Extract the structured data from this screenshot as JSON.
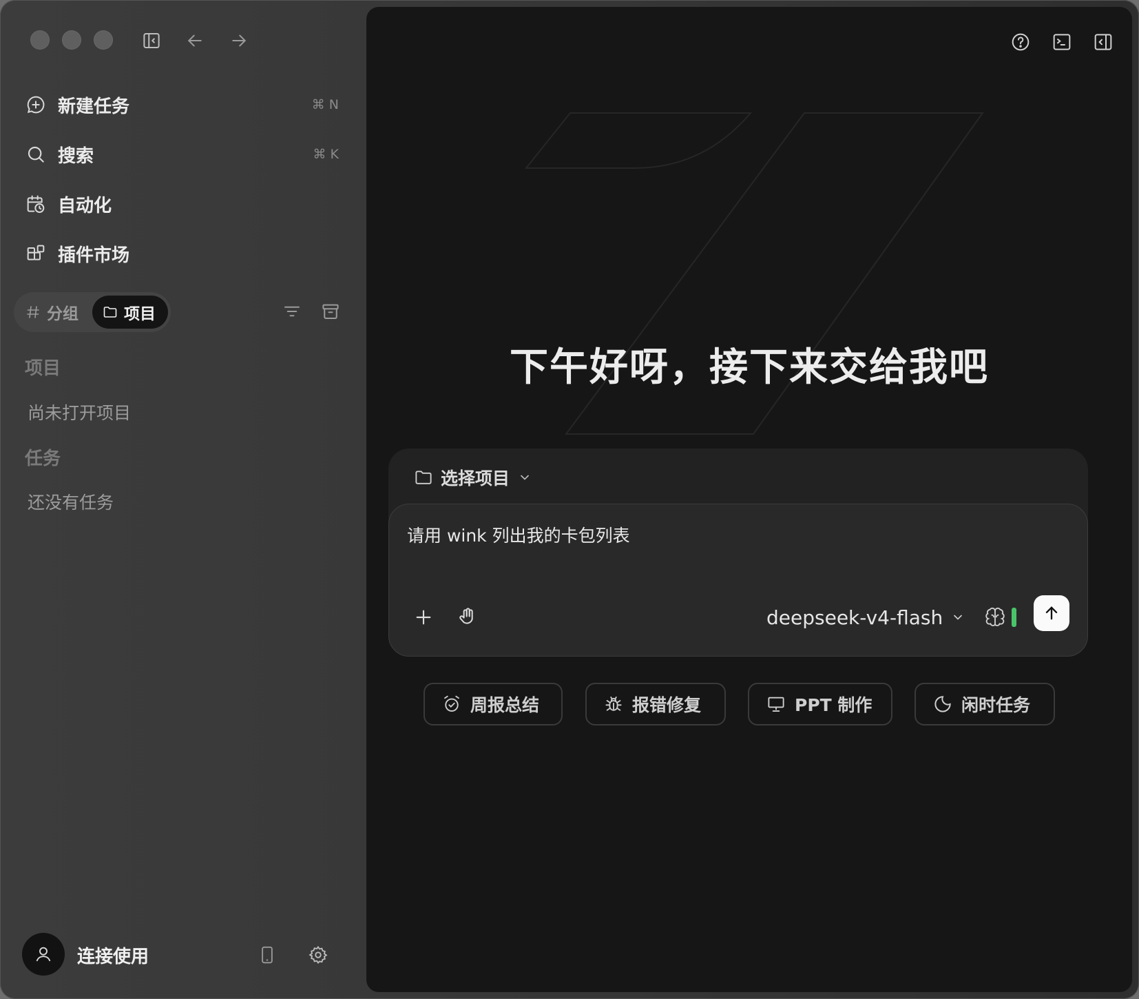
{
  "window": {
    "traffic_lights": [
      "close",
      "minimize",
      "zoom"
    ]
  },
  "toolbar": {
    "icons": [
      "sidebar-toggle-icon",
      "arrow-left-icon",
      "arrow-right-icon"
    ]
  },
  "sidebar": {
    "nav": [
      {
        "label": "新建任务",
        "shortcut": "⌘ N",
        "icon": "new-task-icon"
      },
      {
        "label": "搜索",
        "shortcut": "⌘ K",
        "icon": "search-icon"
      },
      {
        "label": "自动化",
        "shortcut": "",
        "icon": "calendar-clock-icon"
      },
      {
        "label": "插件市场",
        "shortcut": "",
        "icon": "plugin-grid-icon"
      }
    ],
    "segment": {
      "group_label": "分组",
      "project_label": "项目",
      "selected": "项目"
    },
    "sections": {
      "projects_heading": "项目",
      "projects_empty": "尚未打开项目",
      "tasks_heading": "任务",
      "tasks_empty": "还没有任务"
    },
    "footer": {
      "connect_label": "连接使用"
    }
  },
  "main": {
    "top_icons": [
      "help-icon",
      "terminal-icon",
      "right-panel-icon"
    ],
    "greeting": "下午好呀，接下来交给我吧",
    "composer": {
      "project_select_label": "选择项目",
      "prompt_text": "请用 wink 列出我的卡包列表",
      "model_name": "deepseek-v4-flash",
      "level_color": "#4ac46a"
    },
    "quick_actions": [
      {
        "label": "周报总结",
        "icon": "alarm-check-icon"
      },
      {
        "label": "报错修复",
        "icon": "bug-icon"
      },
      {
        "label": "PPT 制作",
        "icon": "presentation-icon"
      },
      {
        "label": "闲时任务",
        "icon": "moon-icon"
      }
    ]
  }
}
